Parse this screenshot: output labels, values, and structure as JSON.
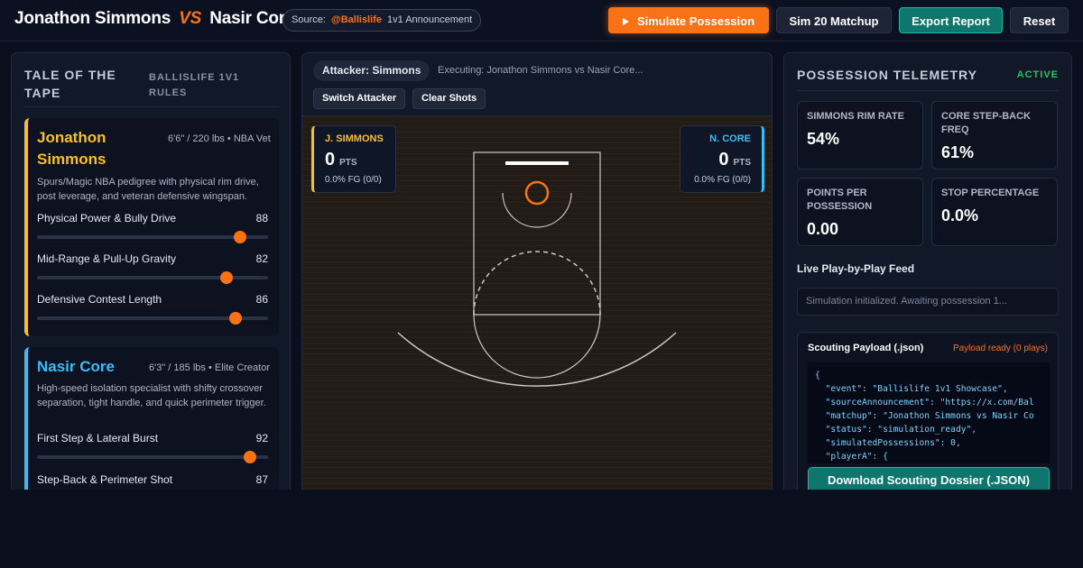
{
  "header": {
    "player_a": "Jonathon Simmons",
    "vs": "VS",
    "player_b": "Nasir Core",
    "source_label": "Source:",
    "source_handle": "@Ballislife",
    "source_suffix": "1v1 Announcement",
    "buttons": {
      "simulate": "Simulate Possession",
      "sim20": "Sim 20 Matchup",
      "export": "Export Report",
      "reset": "Reset"
    }
  },
  "left": {
    "heading": "TALE OF THE TAPE",
    "subheading": "BALLISLIFE 1V1 RULES",
    "player_a": {
      "name": "Jonathon Simmons",
      "meta": "6'6\" / 220 lbs • NBA Vet",
      "desc": "Spurs/Magic NBA pedigree with physical rim drive, post leverage, and veteran defensive wingspan.",
      "attributes": [
        {
          "label": "Physical Power & Bully Drive",
          "value": 88
        },
        {
          "label": "Mid-Range & Pull-Up Gravity",
          "value": 82
        },
        {
          "label": "Defensive Contest Length",
          "value": 86
        }
      ]
    },
    "player_b": {
      "name": "Nasir Core",
      "meta": "6'3\" / 185 lbs • Elite Creator",
      "desc": "High-speed isolation specialist with shifty crossover separation, tight handle, and quick perimeter trigger.",
      "attributes": [
        {
          "label": "First Step & Lateral Burst",
          "value": 92
        },
        {
          "label": "Step-Back & Perimeter Shot",
          "value": 87
        }
      ]
    }
  },
  "middle": {
    "attacker": "Attacker: Simmons",
    "executing": "Executing: Jonathon Simmons vs Nasir Core...",
    "switch_label": "Switch Attacker",
    "clear_label": "Clear Shots",
    "score_a": {
      "name": "J. SIMMONS",
      "pts": "0",
      "pts_label": "PTS",
      "fg": "0.0% FG (0/0)"
    },
    "score_b": {
      "name": "N. CORE",
      "pts": "0",
      "pts_label": "PTS",
      "fg": "0.0% FG (0/0)"
    }
  },
  "right": {
    "heading": "POSSESSION TELEMETRY",
    "status": "ACTIVE",
    "metrics": [
      {
        "label": "SIMMONS RIM RATE",
        "value": "54%"
      },
      {
        "label": "CORE STEP-BACK FREQ",
        "value": "61%"
      },
      {
        "label": "POINTS PER POSSESSION",
        "value": "0.00"
      },
      {
        "label": "STOP PERCENTAGE",
        "value": "0.0%"
      }
    ],
    "feed_title": "Live Play-by-Play Feed",
    "feed_text": "Simulation initialized. Awaiting possession 1...",
    "payload_title": "Scouting Payload (.json)",
    "payload_status": "Payload ready (0 plays)",
    "payload_code": "{\n  \"event\": \"Ballislife 1v1 Showcase\",\n  \"sourceAnnouncement\": \"https://x.com/Bal\n  \"matchup\": \"Jonathon Simmons vs Nasir Co\n  \"status\": \"simulation_ready\",\n  \"simulatedPossessions\": 0,\n  \"playerA\": {",
    "download_label": "Download Scouting Dossier (.JSON)"
  },
  "colors": {
    "accent": "#f97316",
    "player_a": "#fbbf24",
    "player_b": "#38bdf8",
    "teal": "#0f766e",
    "active": "#22c55e"
  }
}
